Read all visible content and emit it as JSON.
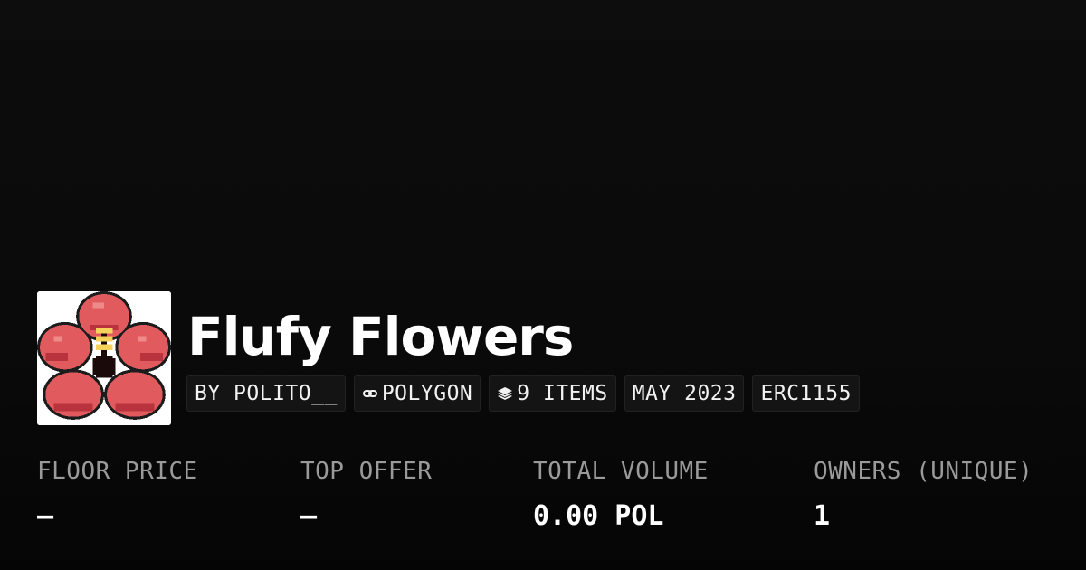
{
  "collection": {
    "title": "Flufy Flowers",
    "image_alt": "hibiscus-pixel-art",
    "chips": {
      "creator": "BY POLITO__",
      "chain": "POLYGON",
      "chain_icon": "polygon-link-icon",
      "items": "9 ITEMS",
      "items_icon": "layers-icon",
      "date": "MAY 2023",
      "standard": "ERC1155"
    }
  },
  "stats": [
    {
      "label": "FLOOR PRICE",
      "value": "–"
    },
    {
      "label": "TOP OFFER",
      "value": "–"
    },
    {
      "label": "TOTAL VOLUME",
      "value": "0.00 POL"
    },
    {
      "label": "OWNERS (UNIQUE)",
      "value": "1"
    }
  ],
  "colors": {
    "background": "#0a0a0a",
    "petal": "#e05a5e",
    "petal_dark": "#b8333d",
    "center": "#1a0a0a",
    "stamen": "#f5d35a"
  }
}
